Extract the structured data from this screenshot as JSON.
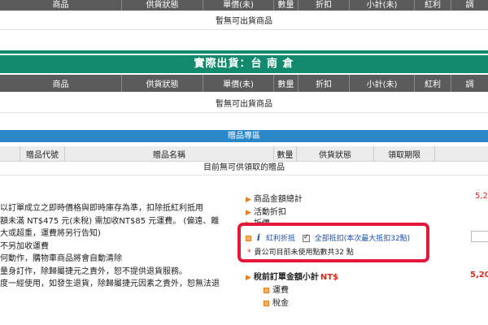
{
  "table1": {
    "columns": [
      "商品",
      "供貨狀態",
      "單價(未)",
      "數量",
      "折扣",
      "小計(未)",
      "紅利",
      "調"
    ],
    "empty_text": "暫無可出貨商品"
  },
  "section2": {
    "title": "實際出貨：台 南 倉",
    "columns": [
      "商品",
      "供貨狀態",
      "單價(未)",
      "數量",
      "折扣",
      "小計(未)",
      "紅利",
      "調"
    ],
    "empty_text": "暫無可出貨商品"
  },
  "gift": {
    "title": "贈品專區",
    "columns": [
      "贈品代號",
      "贈品名稱",
      "數量",
      "供貨狀態",
      "領取期限"
    ],
    "empty_text": "目前無可供領取的贈品"
  },
  "notes": [
    "以訂單成立之即時價格與即時庫存為準，扣除抵紅利抵用",
    "額未滿 NT$475 元(未稅) 需加收NT$85 元運費。 (偏遠、離",
    "大或超重，運費將另行告知)",
    "不另加收運費",
    "何動作，購物車商品將會自動清除",
    "量身訂作，除歸屬捷元之責外，恕不提供退貨服務。",
    "度一經使用，如發生退貨，除歸屬捷元因素之責外，恕無法退"
  ],
  "summary": {
    "item_total": "商品金額總計",
    "item_total_value": "5,2",
    "promo_discount": "活動折扣",
    "discount": "折價",
    "bonus_label": "紅利折抵",
    "bonus_all_label": "全部抵扣(本次最大抵扣32點)",
    "bonus_points_note": "貴公司目前未使用點數共32 點",
    "pre_tax_label": "稅前訂單金額小計",
    "pre_tax_currency": "NT$",
    "pre_tax_value": "5,20",
    "shipping": "運費",
    "tax": "稅金",
    "info_mark": "i",
    "note_star": "*"
  },
  "colors": {
    "header_gray": "#5b5b5b",
    "green_bar": "#138a6e",
    "blue_bar": "#2a87c8",
    "highlight_red": "#e3183a",
    "accent_orange": "#e87e1a",
    "link_blue": "#1b4fa8"
  }
}
